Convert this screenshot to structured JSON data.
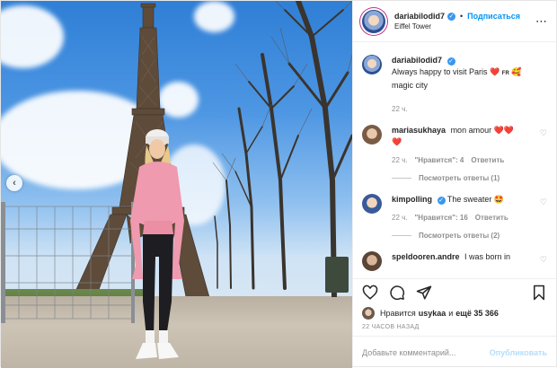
{
  "header": {
    "username": "dariabilodid7",
    "separator": "•",
    "follow_label": "Подписаться",
    "location": "Eiffel Tower",
    "more_icon": "more-horizontal-icon"
  },
  "caption": {
    "username": "dariabilodid7",
    "text_1": "Always happy to visit Paris",
    "emoji_1": "❤️",
    "flag": "FR",
    "emoji_2": "🥰",
    "text_2": "magic city",
    "time": "22 ч."
  },
  "comments": [
    {
      "username": "mariasukhaya",
      "text": "mon amour",
      "emoji": "❤️❤️",
      "emoji_line2": "❤️",
      "time": "22 ч.",
      "likes": "\"Нравится\": 4",
      "reply_label": "Ответить",
      "view_replies": "Посмотреть ответы (1)"
    },
    {
      "username": "kimpolling",
      "text": "The sweater",
      "emoji": "🤩",
      "time": "22 ч.",
      "likes": "\"Нравится\": 16",
      "reply_label": "Ответить",
      "view_replies": "Посмотреть ответы (2)"
    },
    {
      "username": "speldooren.andre",
      "text": "I was born in"
    }
  ],
  "actions": {
    "like_icon": "heart-icon",
    "comment_icon": "comment-icon",
    "share_icon": "share-icon",
    "save_icon": "bookmark-icon"
  },
  "likes": {
    "prefix": "Нравится",
    "user": "usykaa",
    "middle": "и",
    "count": "ещё 35 366"
  },
  "timestamp": "22 ЧАСОВ НАЗАД",
  "add_comment": {
    "placeholder": "Добавьте комментарий...",
    "publish_label": "Опубликовать"
  },
  "colors": {
    "accent": "#0095f6",
    "verified": "#3897f0",
    "muted": "#8e8e8e",
    "publish_disabled": "#b2dffc"
  }
}
